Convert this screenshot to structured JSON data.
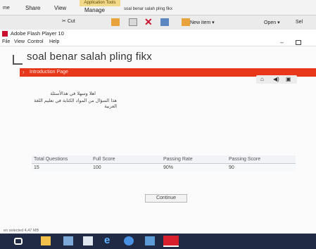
{
  "explorer": {
    "tab_file": "me",
    "tab_share": "Share",
    "tab_view": "View",
    "tab_manage": "Manage",
    "application_tools": "Application Tools",
    "window_title": "soal benar salah pling fikx",
    "cut_label": "Cut",
    "new_item_label": "New item",
    "open_label": "Open",
    "select_label": "Sel"
  },
  "flash": {
    "window_title": "Adobe Flash Player 10",
    "menu": {
      "file": "File",
      "view": "View",
      "control": "Control",
      "help": "Help"
    }
  },
  "course": {
    "title": "soal benar salah pling fikx",
    "page_label": "Introduction Page",
    "intro_line1": "اهلا وسهلا في هذالأسئلة",
    "intro_line2": "هذا السؤال من المواد الكتابة في تعليم اللغة العربية",
    "table_headers": [
      "Total Questions",
      "Full Score",
      "Passing Rate",
      "Passing Score"
    ],
    "table_values": [
      "15",
      "100",
      "90%",
      "90"
    ],
    "continue_label": "Continue"
  },
  "status": {
    "text": "en selected 4,47 MB"
  },
  "colors": {
    "accent_red": "#e8381c",
    "taskbar": "#202a44"
  }
}
